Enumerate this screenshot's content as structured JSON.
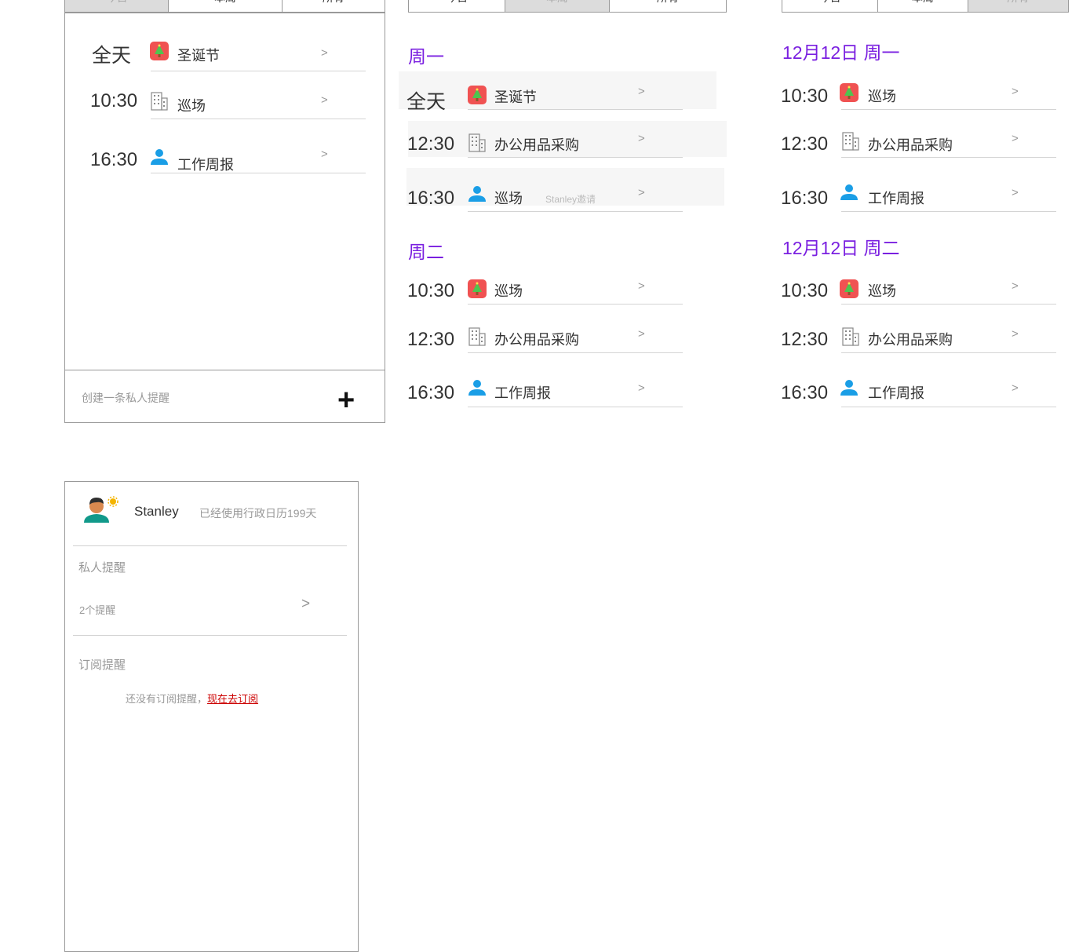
{
  "tabs": {
    "day": "今日",
    "week": "本周",
    "all": "所有"
  },
  "day_view": {
    "rows": [
      {
        "time": "全天",
        "title": "圣诞节",
        "icon": "christmas-tree-icon"
      },
      {
        "time": "10:30",
        "title": "巡场",
        "icon": "building-icon"
      },
      {
        "time": "16:30",
        "title": "工作周报",
        "icon": "person-icon"
      }
    ],
    "footer_placeholder": "创建一条私人提醒",
    "add_symbol": "+"
  },
  "week_view": {
    "groups": [
      {
        "header": "周一",
        "rows": [
          {
            "time": "全天",
            "title": "圣诞节",
            "icon": "christmas-tree-icon"
          },
          {
            "time": "12:30",
            "title": "办公用品采购",
            "icon": "building-icon"
          },
          {
            "time": "16:30",
            "title": "巡场",
            "icon": "person-icon",
            "invite": "Stanley邀请"
          }
        ]
      },
      {
        "header": "周二",
        "rows": [
          {
            "time": "10:30",
            "title": "巡场",
            "icon": "christmas-tree-icon"
          },
          {
            "time": "12:30",
            "title": "办公用品采购",
            "icon": "building-icon"
          },
          {
            "time": "16:30",
            "title": "工作周报",
            "icon": "person-icon"
          }
        ]
      }
    ]
  },
  "all_view": {
    "groups": [
      {
        "header": "12月12日 周一",
        "rows": [
          {
            "time": "10:30",
            "title": "巡场",
            "icon": "christmas-tree-icon"
          },
          {
            "time": "12:30",
            "title": "办公用品采购",
            "icon": "building-icon"
          },
          {
            "time": "16:30",
            "title": "工作周报",
            "icon": "person-icon"
          }
        ]
      },
      {
        "header": "12月12日 周二",
        "rows": [
          {
            "time": "10:30",
            "title": "巡场",
            "icon": "christmas-tree-icon"
          },
          {
            "time": "12:30",
            "title": "办公用品采购",
            "icon": "building-icon"
          },
          {
            "time": "16:30",
            "title": "工作周报",
            "icon": "person-icon"
          }
        ]
      }
    ]
  },
  "arrow": ">",
  "profile": {
    "name": "Stanley",
    "usage": "已经使用行政日历199天",
    "private_section": "私人提醒",
    "private_count": "2个提醒",
    "subscribe_section": "订阅提醒",
    "no_subscribe": "还没有订阅提醒，",
    "subscribe_link": "现在去订阅"
  },
  "colors": {
    "accent": "#7a1fe0",
    "link": "#cc0000",
    "person_icon": "#1a9ee6",
    "tree_bg": "#f05252"
  }
}
